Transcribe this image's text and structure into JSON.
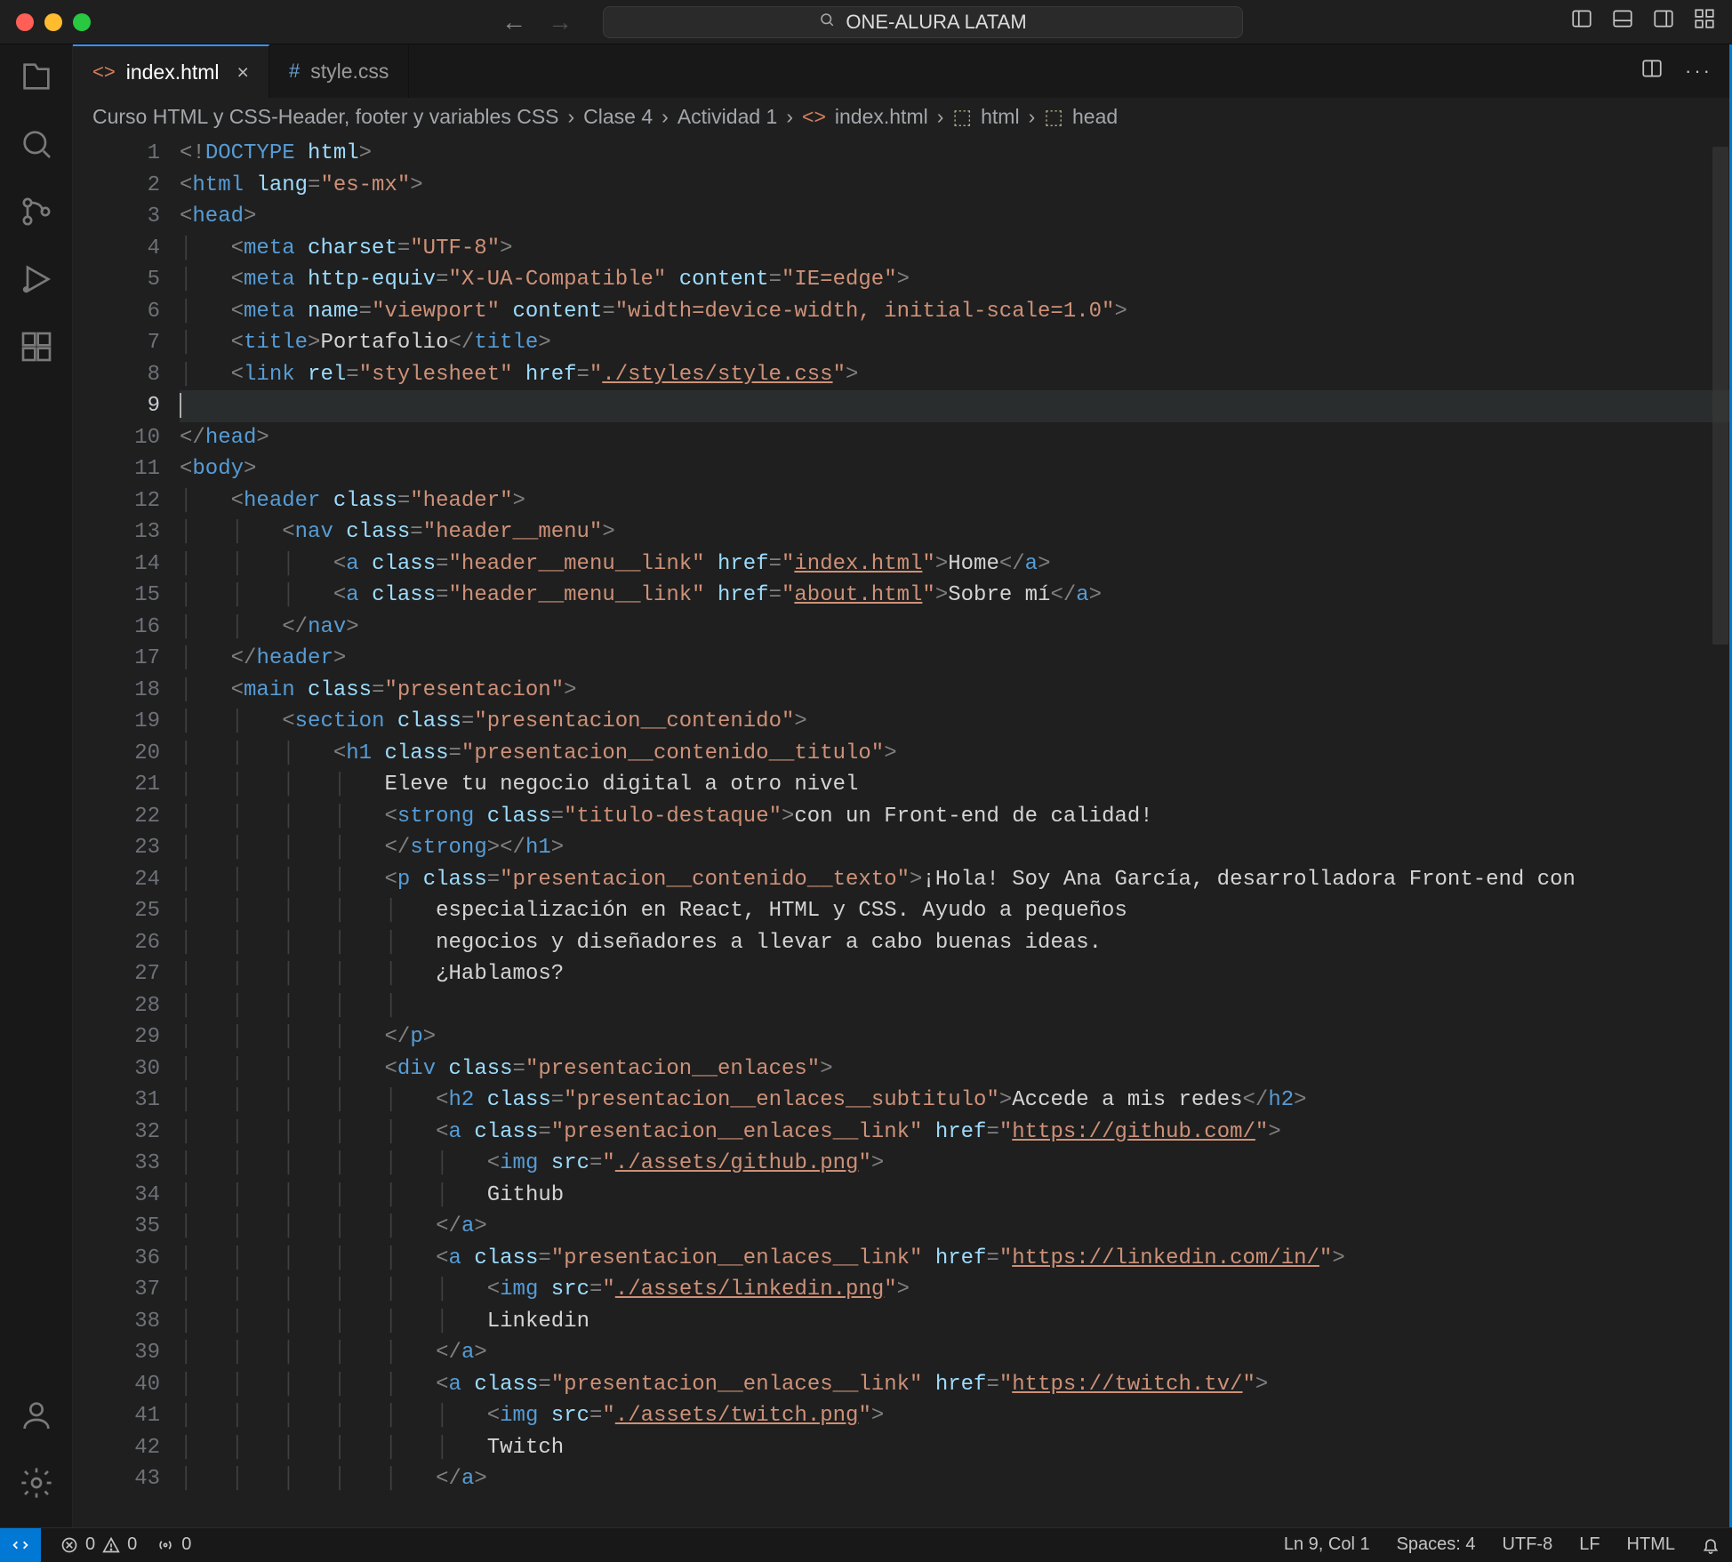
{
  "traffic_colors": {
    "close": "#ff5f57",
    "min": "#febc2e",
    "max": "#28c840"
  },
  "search_project": "ONE-ALURA LATAM",
  "tabs": [
    {
      "label": "index.html",
      "active": true,
      "icon": "<>"
    },
    {
      "label": "style.css",
      "active": false,
      "icon": "#"
    }
  ],
  "breadcrumbs": [
    "Curso HTML y CSS-Header, footer y variables CSS",
    "Clase 4",
    "Actividad 1",
    "index.html",
    "html",
    "head"
  ],
  "line_count": 43,
  "current_line": 9,
  "code_lines": [
    [
      [
        "t-gray",
        "<!"
      ],
      [
        "t-doctype",
        "DOCTYPE"
      ],
      [
        "t-text",
        " "
      ],
      [
        "t-attr",
        "html"
      ],
      [
        "t-gray",
        ">"
      ]
    ],
    [
      [
        "t-gray",
        "<"
      ],
      [
        "t-tag",
        "html"
      ],
      [
        "t-text",
        " "
      ],
      [
        "t-attr",
        "lang"
      ],
      [
        "t-gray",
        "="
      ],
      [
        "t-str",
        "\"es-mx\""
      ],
      [
        "t-gray",
        ">"
      ]
    ],
    [
      [
        "t-gray",
        "<"
      ],
      [
        "t-tag",
        "head"
      ],
      [
        "t-gray",
        ">"
      ]
    ],
    [
      [
        "ind",
        1
      ],
      [
        "t-gray",
        "<"
      ],
      [
        "t-tag",
        "meta"
      ],
      [
        "t-text",
        " "
      ],
      [
        "t-attr",
        "charset"
      ],
      [
        "t-gray",
        "="
      ],
      [
        "t-str",
        "\"UTF-8\""
      ],
      [
        "t-gray",
        ">"
      ]
    ],
    [
      [
        "ind",
        1
      ],
      [
        "t-gray",
        "<"
      ],
      [
        "t-tag",
        "meta"
      ],
      [
        "t-text",
        " "
      ],
      [
        "t-attr",
        "http-equiv"
      ],
      [
        "t-gray",
        "="
      ],
      [
        "t-str",
        "\"X-UA-Compatible\""
      ],
      [
        "t-text",
        " "
      ],
      [
        "t-attr",
        "content"
      ],
      [
        "t-gray",
        "="
      ],
      [
        "t-str",
        "\"IE=edge\""
      ],
      [
        "t-gray",
        ">"
      ]
    ],
    [
      [
        "ind",
        1
      ],
      [
        "t-gray",
        "<"
      ],
      [
        "t-tag",
        "meta"
      ],
      [
        "t-text",
        " "
      ],
      [
        "t-attr",
        "name"
      ],
      [
        "t-gray",
        "="
      ],
      [
        "t-str",
        "\"viewport\""
      ],
      [
        "t-text",
        " "
      ],
      [
        "t-attr",
        "content"
      ],
      [
        "t-gray",
        "="
      ],
      [
        "t-str",
        "\"width=device-width, initial-scale=1.0\""
      ],
      [
        "t-gray",
        ">"
      ]
    ],
    [
      [
        "ind",
        1
      ],
      [
        "t-gray",
        "<"
      ],
      [
        "t-tag",
        "title"
      ],
      [
        "t-gray",
        ">"
      ],
      [
        "t-text",
        "Portafolio"
      ],
      [
        "t-gray",
        "</"
      ],
      [
        "t-tag",
        "title"
      ],
      [
        "t-gray",
        ">"
      ]
    ],
    [
      [
        "ind",
        1
      ],
      [
        "t-gray",
        "<"
      ],
      [
        "t-tag",
        "link"
      ],
      [
        "t-text",
        " "
      ],
      [
        "t-attr",
        "rel"
      ],
      [
        "t-gray",
        "="
      ],
      [
        "t-str",
        "\"stylesheet\""
      ],
      [
        "t-text",
        " "
      ],
      [
        "t-attr",
        "href"
      ],
      [
        "t-gray",
        "="
      ],
      [
        "t-str",
        "\""
      ],
      [
        "t-link",
        "./styles/style.css"
      ],
      [
        "t-str",
        "\""
      ],
      [
        "t-gray",
        ">"
      ]
    ],
    [
      [
        "cursor",
        ""
      ]
    ],
    [
      [
        "t-gray",
        "</"
      ],
      [
        "t-tag",
        "head"
      ],
      [
        "t-gray",
        ">"
      ]
    ],
    [
      [
        "t-gray",
        "<"
      ],
      [
        "t-tag",
        "body"
      ],
      [
        "t-gray",
        ">"
      ]
    ],
    [
      [
        "ind",
        1
      ],
      [
        "t-gray",
        "<"
      ],
      [
        "t-tag",
        "header"
      ],
      [
        "t-text",
        " "
      ],
      [
        "t-attr",
        "class"
      ],
      [
        "t-gray",
        "="
      ],
      [
        "t-str",
        "\"header\""
      ],
      [
        "t-gray",
        ">"
      ]
    ],
    [
      [
        "ind",
        2
      ],
      [
        "t-gray",
        "<"
      ],
      [
        "t-tag",
        "nav"
      ],
      [
        "t-text",
        " "
      ],
      [
        "t-attr",
        "class"
      ],
      [
        "t-gray",
        "="
      ],
      [
        "t-str",
        "\"header__menu\""
      ],
      [
        "t-gray",
        ">"
      ]
    ],
    [
      [
        "ind",
        3
      ],
      [
        "t-gray",
        "<"
      ],
      [
        "t-tag",
        "a"
      ],
      [
        "t-text",
        " "
      ],
      [
        "t-attr",
        "class"
      ],
      [
        "t-gray",
        "="
      ],
      [
        "t-str",
        "\"header__menu__link\""
      ],
      [
        "t-text",
        " "
      ],
      [
        "t-attr",
        "href"
      ],
      [
        "t-gray",
        "="
      ],
      [
        "t-str",
        "\""
      ],
      [
        "t-link",
        "index.html"
      ],
      [
        "t-str",
        "\""
      ],
      [
        "t-gray",
        ">"
      ],
      [
        "t-text",
        "Home"
      ],
      [
        "t-gray",
        "</"
      ],
      [
        "t-tag",
        "a"
      ],
      [
        "t-gray",
        ">"
      ]
    ],
    [
      [
        "ind",
        3
      ],
      [
        "t-gray",
        "<"
      ],
      [
        "t-tag",
        "a"
      ],
      [
        "t-text",
        " "
      ],
      [
        "t-attr",
        "class"
      ],
      [
        "t-gray",
        "="
      ],
      [
        "t-str",
        "\"header__menu__link\""
      ],
      [
        "t-text",
        " "
      ],
      [
        "t-attr",
        "href"
      ],
      [
        "t-gray",
        "="
      ],
      [
        "t-str",
        "\""
      ],
      [
        "t-link",
        "about.html"
      ],
      [
        "t-str",
        "\""
      ],
      [
        "t-gray",
        ">"
      ],
      [
        "t-text",
        "Sobre mí"
      ],
      [
        "t-gray",
        "</"
      ],
      [
        "t-tag",
        "a"
      ],
      [
        "t-gray",
        ">"
      ]
    ],
    [
      [
        "ind",
        2
      ],
      [
        "t-gray",
        "</"
      ],
      [
        "t-tag",
        "nav"
      ],
      [
        "t-gray",
        ">"
      ]
    ],
    [
      [
        "ind",
        1
      ],
      [
        "t-gray",
        "</"
      ],
      [
        "t-tag",
        "header"
      ],
      [
        "t-gray",
        ">"
      ]
    ],
    [
      [
        "ind",
        1
      ],
      [
        "t-gray",
        "<"
      ],
      [
        "t-tag",
        "main"
      ],
      [
        "t-text",
        " "
      ],
      [
        "t-attr",
        "class"
      ],
      [
        "t-gray",
        "="
      ],
      [
        "t-str",
        "\"presentacion\""
      ],
      [
        "t-gray",
        ">"
      ]
    ],
    [
      [
        "ind",
        2
      ],
      [
        "t-gray",
        "<"
      ],
      [
        "t-tag",
        "section"
      ],
      [
        "t-text",
        " "
      ],
      [
        "t-attr",
        "class"
      ],
      [
        "t-gray",
        "="
      ],
      [
        "t-str",
        "\"presentacion__contenido\""
      ],
      [
        "t-gray",
        ">"
      ]
    ],
    [
      [
        "ind",
        3
      ],
      [
        "t-gray",
        "<"
      ],
      [
        "t-tag",
        "h1"
      ],
      [
        "t-text",
        " "
      ],
      [
        "t-attr",
        "class"
      ],
      [
        "t-gray",
        "="
      ],
      [
        "t-str",
        "\"presentacion__contenido__titulo\""
      ],
      [
        "t-gray",
        ">"
      ]
    ],
    [
      [
        "ind",
        4
      ],
      [
        "t-text",
        "Eleve tu negocio digital a otro nivel"
      ]
    ],
    [
      [
        "ind",
        4
      ],
      [
        "t-gray",
        "<"
      ],
      [
        "t-tag",
        "strong"
      ],
      [
        "t-text",
        " "
      ],
      [
        "t-attr",
        "class"
      ],
      [
        "t-gray",
        "="
      ],
      [
        "t-str",
        "\"titulo-destaque\""
      ],
      [
        "t-gray",
        ">"
      ],
      [
        "t-text",
        "con un Front-end de calidad!"
      ]
    ],
    [
      [
        "ind",
        4
      ],
      [
        "t-gray",
        "</"
      ],
      [
        "t-tag",
        "strong"
      ],
      [
        "t-gray",
        "></"
      ],
      [
        "t-tag",
        "h1"
      ],
      [
        "t-gray",
        ">"
      ]
    ],
    [
      [
        "ind",
        4
      ],
      [
        "t-gray",
        "<"
      ],
      [
        "t-tag",
        "p"
      ],
      [
        "t-text",
        " "
      ],
      [
        "t-attr",
        "class"
      ],
      [
        "t-gray",
        "="
      ],
      [
        "t-str",
        "\"presentacion__contenido__texto\""
      ],
      [
        "t-gray",
        ">"
      ],
      [
        "t-text",
        "¡Hola! Soy Ana García, desarrolladora Front-end con"
      ]
    ],
    [
      [
        "ind",
        5
      ],
      [
        "t-text",
        "especialización en React, HTML y CSS. Ayudo a pequeños"
      ]
    ],
    [
      [
        "ind",
        5
      ],
      [
        "t-text",
        "negocios y diseñadores a llevar a cabo buenas ideas."
      ]
    ],
    [
      [
        "ind",
        5
      ],
      [
        "t-text",
        "¿Hablamos?"
      ]
    ],
    [
      [
        "ind",
        5
      ]
    ],
    [
      [
        "ind",
        4
      ],
      [
        "t-gray",
        "</"
      ],
      [
        "t-tag",
        "p"
      ],
      [
        "t-gray",
        ">"
      ]
    ],
    [
      [
        "ind",
        4
      ],
      [
        "t-gray",
        "<"
      ],
      [
        "t-tag",
        "div"
      ],
      [
        "t-text",
        " "
      ],
      [
        "t-attr",
        "class"
      ],
      [
        "t-gray",
        "="
      ],
      [
        "t-str",
        "\"presentacion__enlaces\""
      ],
      [
        "t-gray",
        ">"
      ]
    ],
    [
      [
        "ind",
        5
      ],
      [
        "t-gray",
        "<"
      ],
      [
        "t-tag",
        "h2"
      ],
      [
        "t-text",
        " "
      ],
      [
        "t-attr",
        "class"
      ],
      [
        "t-gray",
        "="
      ],
      [
        "t-str",
        "\"presentacion__enlaces__subtitulo\""
      ],
      [
        "t-gray",
        ">"
      ],
      [
        "t-text",
        "Accede a mis redes"
      ],
      [
        "t-gray",
        "</"
      ],
      [
        "t-tag",
        "h2"
      ],
      [
        "t-gray",
        ">"
      ]
    ],
    [
      [
        "ind",
        5
      ],
      [
        "t-gray",
        "<"
      ],
      [
        "t-tag",
        "a"
      ],
      [
        "t-text",
        " "
      ],
      [
        "t-attr",
        "class"
      ],
      [
        "t-gray",
        "="
      ],
      [
        "t-str",
        "\"presentacion__enlaces__link\""
      ],
      [
        "t-text",
        " "
      ],
      [
        "t-attr",
        "href"
      ],
      [
        "t-gray",
        "="
      ],
      [
        "t-str",
        "\""
      ],
      [
        "t-link",
        "https://github.com/"
      ],
      [
        "t-str",
        "\""
      ],
      [
        "t-gray",
        ">"
      ]
    ],
    [
      [
        "ind",
        6
      ],
      [
        "t-gray",
        "<"
      ],
      [
        "t-tag",
        "img"
      ],
      [
        "t-text",
        " "
      ],
      [
        "t-attr",
        "src"
      ],
      [
        "t-gray",
        "="
      ],
      [
        "t-str",
        "\""
      ],
      [
        "t-link",
        "./assets/github.png"
      ],
      [
        "t-str",
        "\""
      ],
      [
        "t-gray",
        ">"
      ]
    ],
    [
      [
        "ind",
        6
      ],
      [
        "t-text",
        "Github"
      ]
    ],
    [
      [
        "ind",
        5
      ],
      [
        "t-gray",
        "</"
      ],
      [
        "t-tag",
        "a"
      ],
      [
        "t-gray",
        ">"
      ]
    ],
    [
      [
        "ind",
        5
      ],
      [
        "t-gray",
        "<"
      ],
      [
        "t-tag",
        "a"
      ],
      [
        "t-text",
        " "
      ],
      [
        "t-attr",
        "class"
      ],
      [
        "t-gray",
        "="
      ],
      [
        "t-str",
        "\"presentacion__enlaces__link\""
      ],
      [
        "t-text",
        " "
      ],
      [
        "t-attr",
        "href"
      ],
      [
        "t-gray",
        "="
      ],
      [
        "t-str",
        "\""
      ],
      [
        "t-link",
        "https://linkedin.com/in/"
      ],
      [
        "t-str",
        "\""
      ],
      [
        "t-gray",
        ">"
      ]
    ],
    [
      [
        "ind",
        6
      ],
      [
        "t-gray",
        "<"
      ],
      [
        "t-tag",
        "img"
      ],
      [
        "t-text",
        " "
      ],
      [
        "t-attr",
        "src"
      ],
      [
        "t-gray",
        "="
      ],
      [
        "t-str",
        "\""
      ],
      [
        "t-link",
        "./assets/linkedin.png"
      ],
      [
        "t-str",
        "\""
      ],
      [
        "t-gray",
        ">"
      ]
    ],
    [
      [
        "ind",
        6
      ],
      [
        "t-text",
        "Linkedin"
      ]
    ],
    [
      [
        "ind",
        5
      ],
      [
        "t-gray",
        "</"
      ],
      [
        "t-tag",
        "a"
      ],
      [
        "t-gray",
        ">"
      ]
    ],
    [
      [
        "ind",
        5
      ],
      [
        "t-gray",
        "<"
      ],
      [
        "t-tag",
        "a"
      ],
      [
        "t-text",
        " "
      ],
      [
        "t-attr",
        "class"
      ],
      [
        "t-gray",
        "="
      ],
      [
        "t-str",
        "\"presentacion__enlaces__link\""
      ],
      [
        "t-text",
        " "
      ],
      [
        "t-attr",
        "href"
      ],
      [
        "t-gray",
        "="
      ],
      [
        "t-str",
        "\""
      ],
      [
        "t-link",
        "https://twitch.tv/"
      ],
      [
        "t-str",
        "\""
      ],
      [
        "t-gray",
        ">"
      ]
    ],
    [
      [
        "ind",
        6
      ],
      [
        "t-gray",
        "<"
      ],
      [
        "t-tag",
        "img"
      ],
      [
        "t-text",
        " "
      ],
      [
        "t-attr",
        "src"
      ],
      [
        "t-gray",
        "="
      ],
      [
        "t-str",
        "\""
      ],
      [
        "t-link",
        "./assets/twitch.png"
      ],
      [
        "t-str",
        "\""
      ],
      [
        "t-gray",
        ">"
      ]
    ],
    [
      [
        "ind",
        6
      ],
      [
        "t-text",
        "Twitch"
      ]
    ],
    [
      [
        "ind",
        5
      ],
      [
        "t-gray",
        "</"
      ],
      [
        "t-tag",
        "a"
      ],
      [
        "t-gray",
        ">"
      ]
    ]
  ],
  "status": {
    "errors": "0",
    "warnings": "0",
    "ports": "0",
    "cursor": "Ln 9, Col 1",
    "spaces": "Spaces: 4",
    "encoding": "UTF-8",
    "eol": "LF",
    "lang": "HTML"
  }
}
